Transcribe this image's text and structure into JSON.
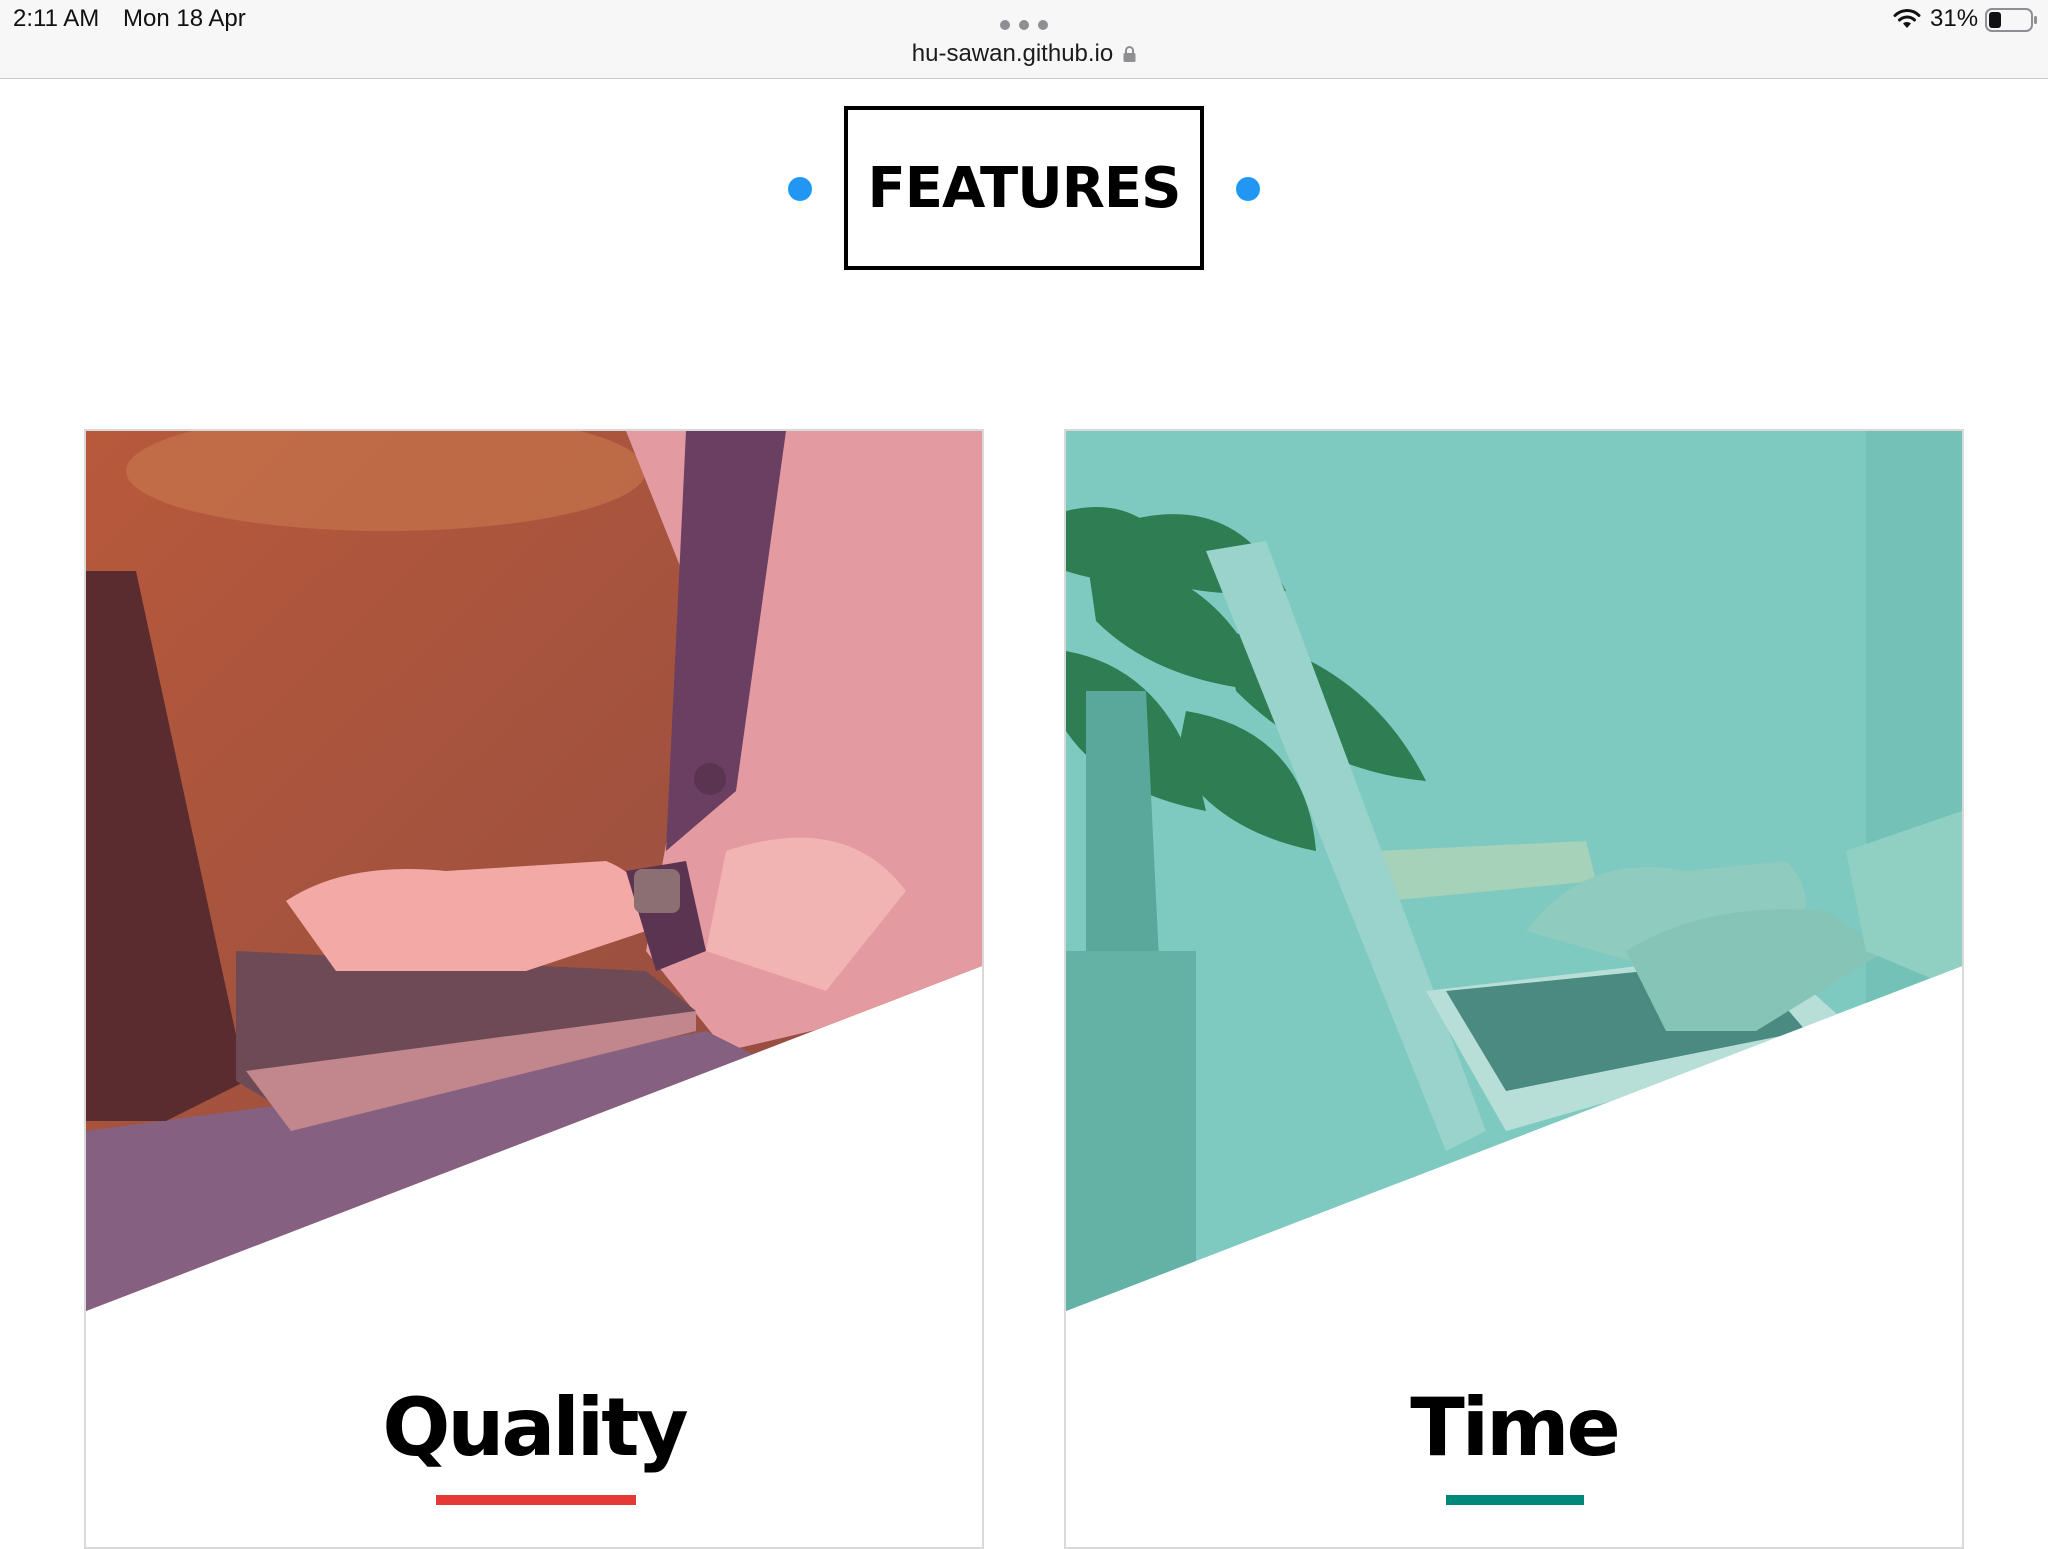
{
  "status_bar": {
    "time": "2:11 AM",
    "date": "Mon 18 Apr",
    "url": "hu-sawan.github.io",
    "battery": "31%",
    "icons": [
      "more-dots-icon",
      "lock-icon",
      "wifi-icon",
      "battery-icon"
    ]
  },
  "section": {
    "heading": "FEATURES",
    "accent_color": "#2196f3"
  },
  "cards": [
    {
      "title": "Quality",
      "overlay_color": "#e57373",
      "bar_color": "#e53935",
      "image": "woman-typing-on-laptop-photo"
    },
    {
      "title": "Time",
      "overlay_color": "#4db6ac",
      "bar_color": "#00897b",
      "image": "hands-typing-on-laptop-with-plant-photo"
    }
  ]
}
